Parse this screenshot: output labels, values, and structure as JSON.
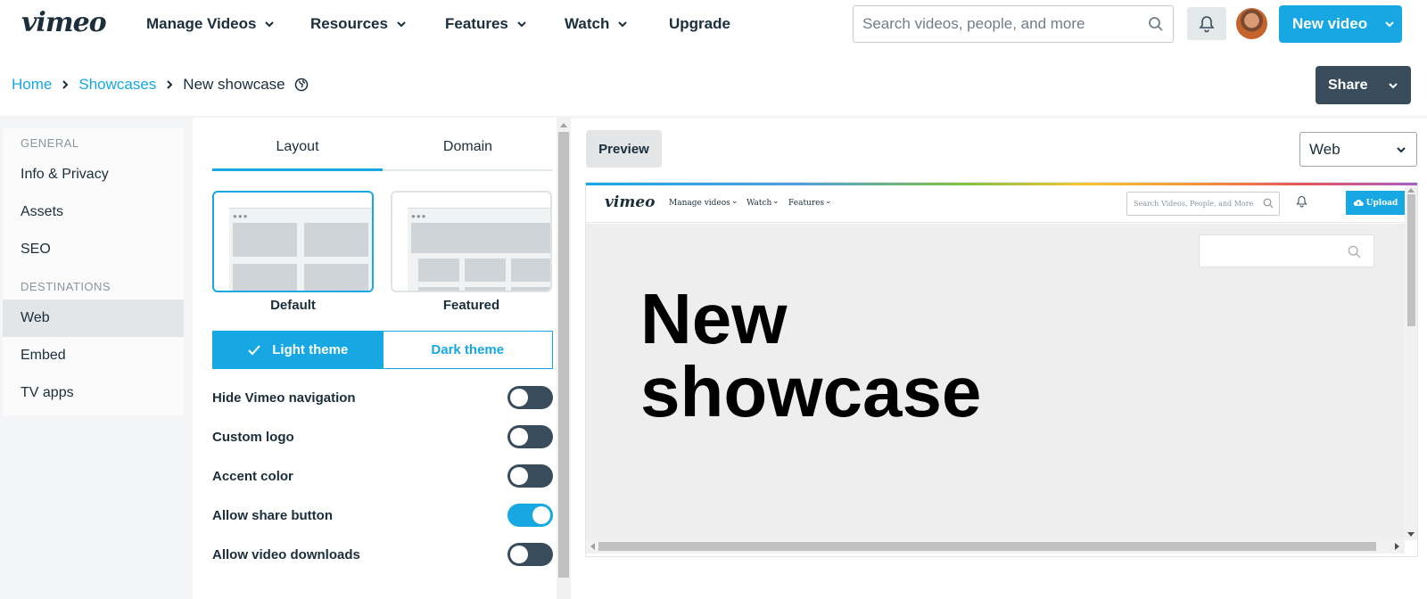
{
  "brand": {
    "logo": "vimeo",
    "accent": "#17a8e3",
    "dark": "#384c5c"
  },
  "nav": {
    "items": [
      {
        "label": "Manage Videos",
        "has_chevron": true
      },
      {
        "label": "Resources",
        "has_chevron": true
      },
      {
        "label": "Features",
        "has_chevron": true
      },
      {
        "label": "Watch",
        "has_chevron": true
      },
      {
        "label": "Upgrade",
        "has_chevron": false
      }
    ],
    "search_placeholder": "Search videos, people, and more",
    "new_video_label": "New video"
  },
  "breadcrumb": {
    "home": "Home",
    "showcases": "Showcases",
    "current": "New showcase",
    "share_label": "Share"
  },
  "sidebar": {
    "general_heading": "GENERAL",
    "destinations_heading": "DESTINATIONS",
    "general_items": [
      "Info & Privacy",
      "Assets",
      "SEO"
    ],
    "destination_items": [
      "Web",
      "Embed",
      "TV apps"
    ],
    "active_item": "Web"
  },
  "panel": {
    "tabs": [
      "Layout",
      "Domain"
    ],
    "active_tab": "Layout",
    "layouts": [
      "Default",
      "Featured"
    ],
    "selected_layout": "Default",
    "themes": {
      "light": "Light theme",
      "dark": "Dark theme",
      "selected": "light"
    },
    "toggles": [
      {
        "label": "Hide Vimeo navigation",
        "on": false
      },
      {
        "label": "Custom logo",
        "on": false
      },
      {
        "label": "Accent color",
        "on": false
      },
      {
        "label": "Allow share button",
        "on": true
      },
      {
        "label": "Allow video downloads",
        "on": false
      }
    ]
  },
  "preview": {
    "button_label": "Preview",
    "device_select": "Web",
    "mini": {
      "logo": "vimeo",
      "links": [
        "Manage videos",
        "Watch",
        "Features"
      ],
      "search_placeholder": "Search Videos, People, and More",
      "upload_label": "Upload"
    },
    "showcase_title_line1": "New",
    "showcase_title_line2": "showcase"
  }
}
